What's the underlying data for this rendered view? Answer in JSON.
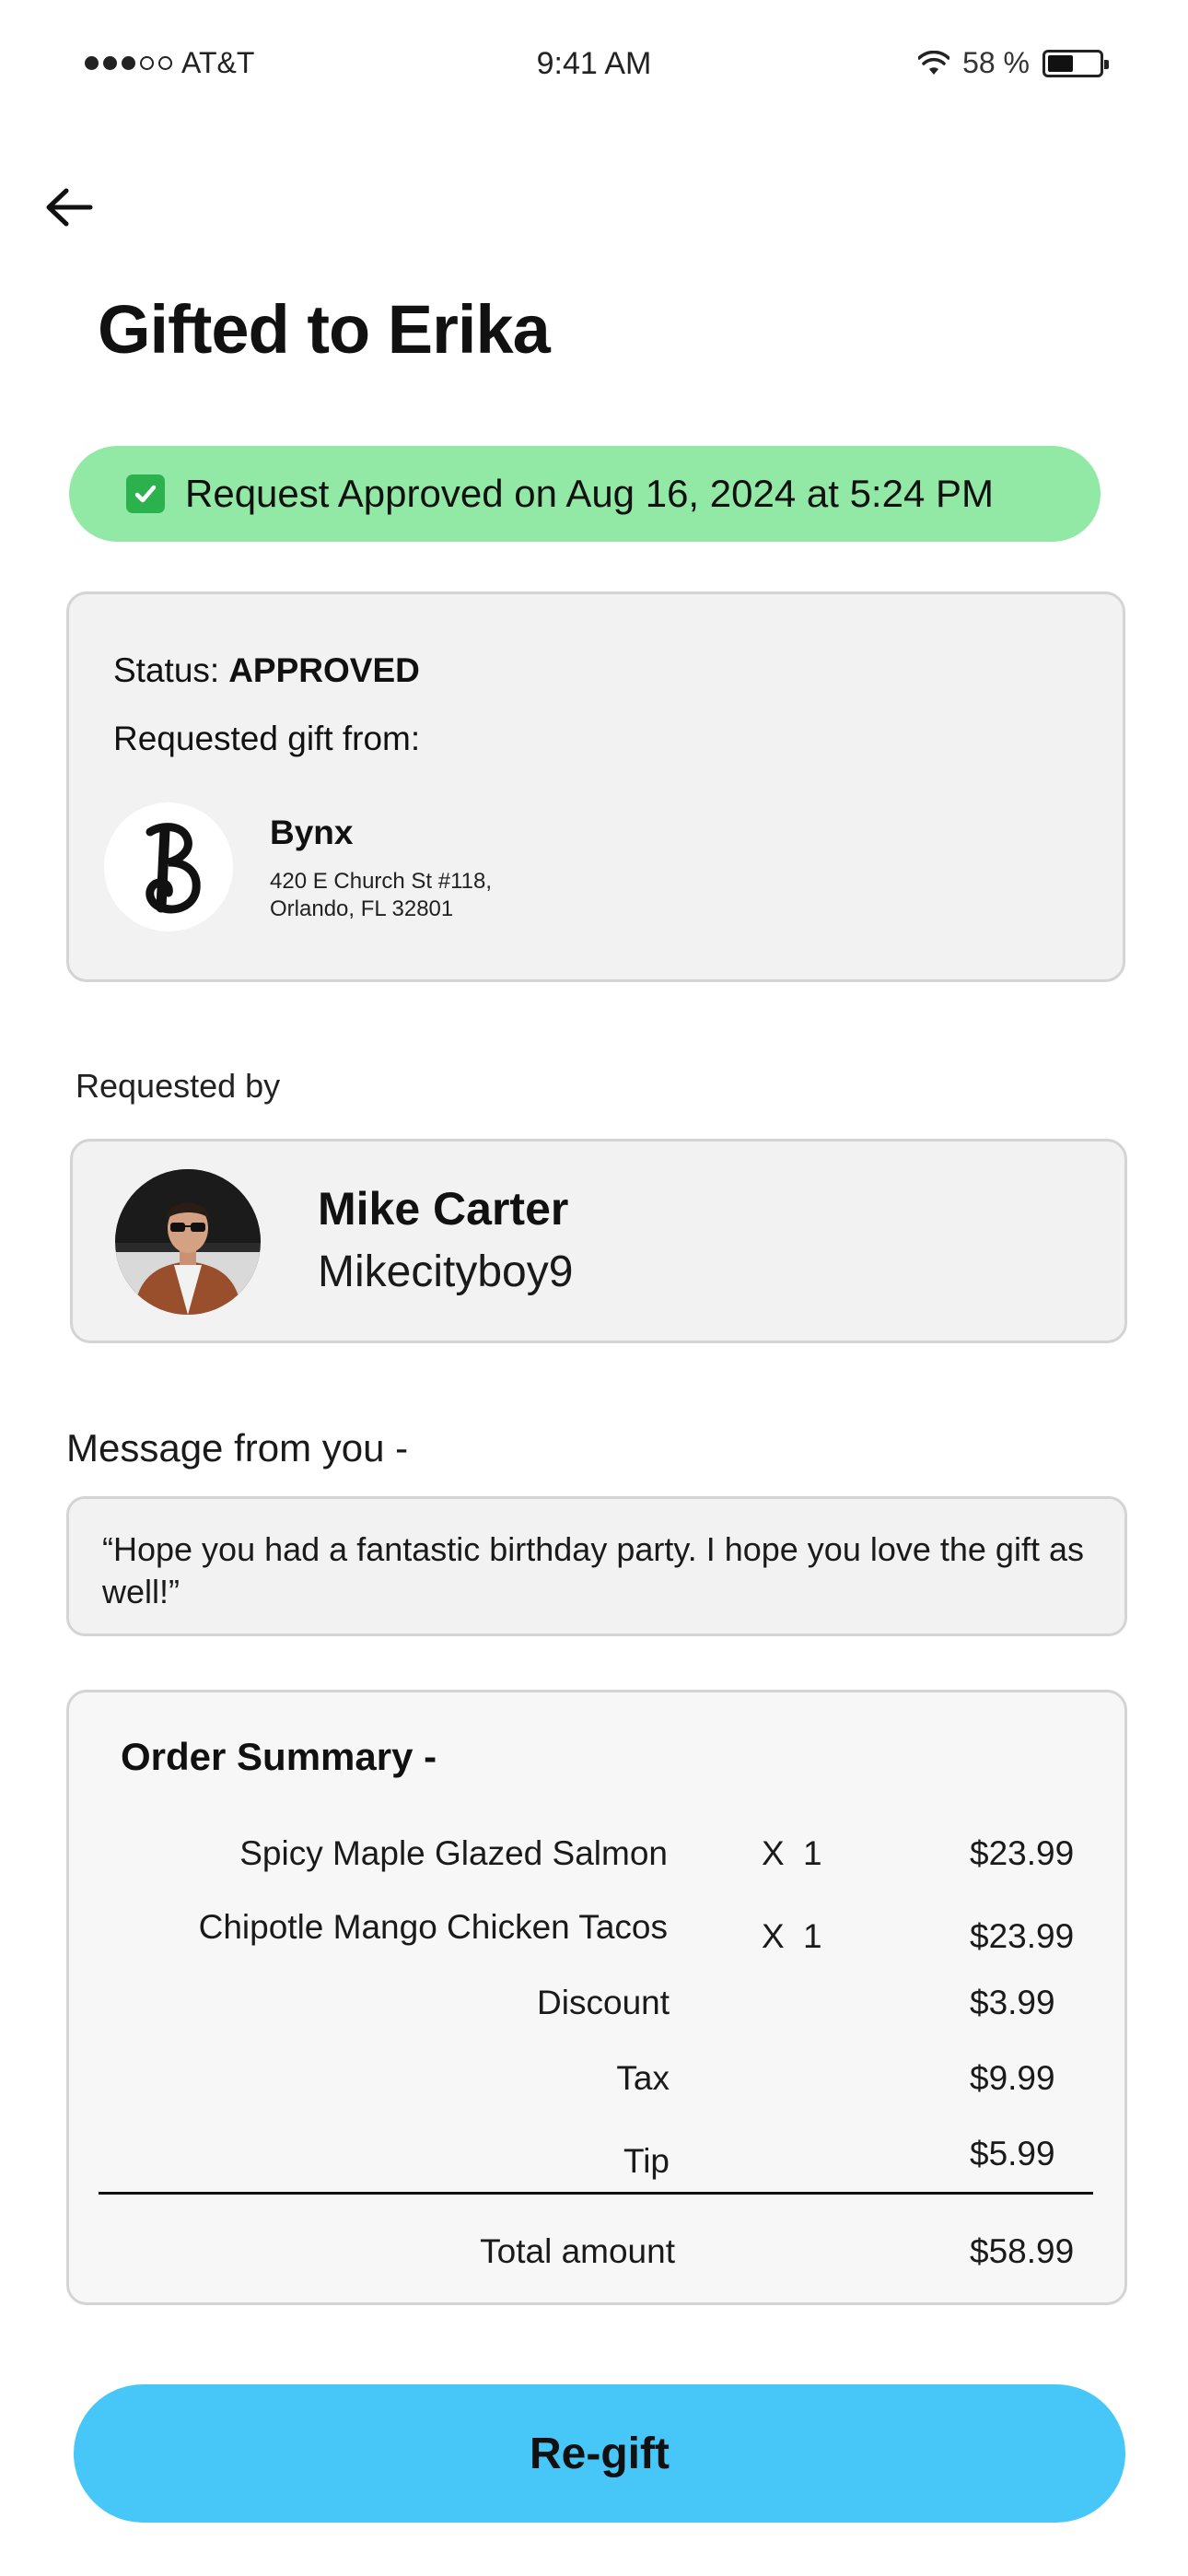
{
  "status_bar": {
    "carrier": "AT&T",
    "time": "9:41 AM",
    "battery_text": "58 %",
    "battery_level": 0.58,
    "signal_bars_filled": 3,
    "signal_bars_total": 5
  },
  "header": {
    "back_icon": "arrow-left-icon",
    "title": "Gifted to Erika"
  },
  "banner": {
    "icon": "check-mark-icon",
    "text": "Request Approved on Aug 16, 2024 at 5:24 PM",
    "background_color": "#92e8a5"
  },
  "status_card": {
    "status_label": "Status:",
    "status_value": "APPROVED",
    "requested_from_label": "Requested gift from:",
    "store": {
      "logo_icon": "bynx-logo",
      "name": "Bynx",
      "address_line1": "420 E Church St #118,",
      "address_line2": "Orlando, FL 32801"
    }
  },
  "requested_by": {
    "label": "Requested by",
    "name": "Mike Carter",
    "username": "Mikecityboy9",
    "avatar_icon": "user-avatar-photo"
  },
  "message": {
    "label": "Message from you -",
    "text": "“Hope you had a fantastic birthday party. I hope you love the gift as well!”"
  },
  "order_summary": {
    "title": "Order Summary -",
    "items": [
      {
        "name": "Spicy Maple Glazed Salmon",
        "qty_prefix": "X",
        "qty": "1",
        "price": "$23.99"
      },
      {
        "name": "Chipotle Mango Chicken Tacos",
        "qty_prefix": "X",
        "qty": "1",
        "price": "$23.99"
      }
    ],
    "discount": {
      "label": "Discount",
      "value": "$3.99"
    },
    "tax": {
      "label": "Tax",
      "value": "$9.99"
    },
    "tip": {
      "label": "Tip",
      "value": "$5.99"
    },
    "total": {
      "label": "Total amount",
      "value": "$58.99"
    }
  },
  "actions": {
    "regift_label": "Re-gift",
    "regift_color": "#47c7f8"
  }
}
